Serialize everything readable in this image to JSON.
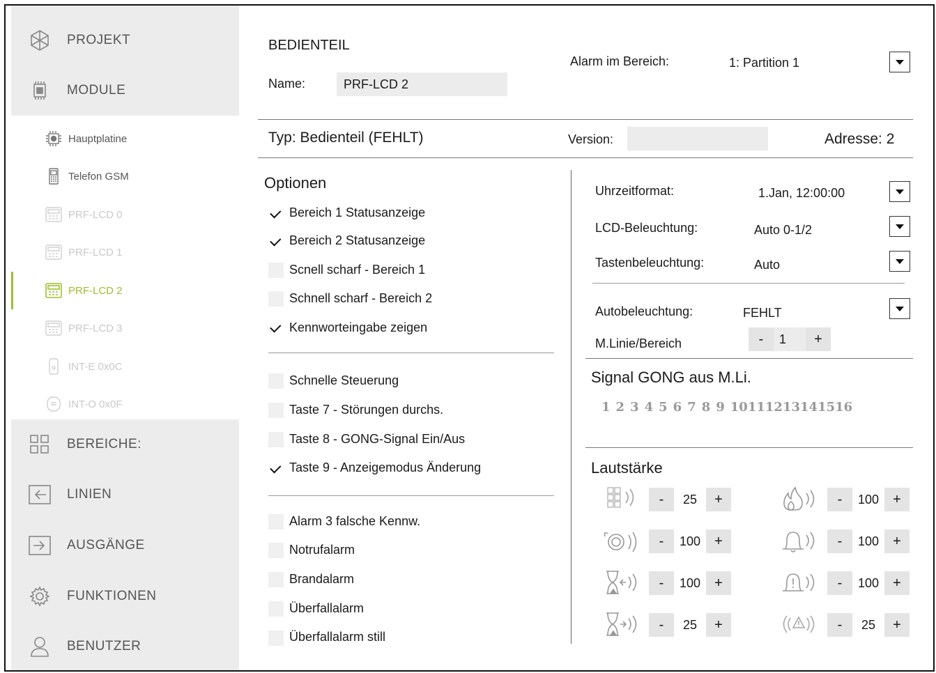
{
  "sidebar": {
    "main_top": [
      {
        "label": "PROJEKT",
        "icon": "project-icon"
      },
      {
        "label": "MODULE",
        "icon": "module-icon"
      }
    ],
    "sub_items": [
      {
        "label": "Hauptplatine",
        "state": "normal"
      },
      {
        "label": "Telefon GSM",
        "state": "normal"
      },
      {
        "label": "PRF-LCD 0",
        "state": "disabled"
      },
      {
        "label": "PRF-LCD 1",
        "state": "disabled"
      },
      {
        "label": "PRF-LCD 2",
        "state": "active"
      },
      {
        "label": "PRF-LCD 3",
        "state": "disabled"
      },
      {
        "label": "INT-E 0x0C",
        "state": "disabled"
      },
      {
        "label": "INT-O 0x0F",
        "state": "disabled"
      }
    ],
    "main_bottom": [
      {
        "label": "BEREICHE:",
        "icon": "partitions-icon"
      },
      {
        "label": "LINIEN",
        "icon": "zones-icon"
      },
      {
        "label": "AUSGÄNGE",
        "icon": "outputs-icon"
      },
      {
        "label": "FUNKTIONEN",
        "icon": "functions-icon"
      },
      {
        "label": "BENUTZER",
        "icon": "user-icon"
      }
    ],
    "accent_color": "#9cbf2b"
  },
  "header": {
    "title": "BEDIENTEIL",
    "name_label": "Name:",
    "name_value": "PRF-LCD 2",
    "alarm_label": "Alarm im Bereich:",
    "alarm_value": "1: Partition 1"
  },
  "typebar": {
    "type_text": "Typ: Bedienteil (FEHLT)",
    "version_label": "Version:",
    "version_value": "",
    "address_text": "Adresse: 2"
  },
  "options": {
    "heading": "Optionen",
    "group1": [
      {
        "label": "Bereich 1 Statusanzeige",
        "checked": true
      },
      {
        "label": "Bereich 2 Statusanzeige",
        "checked": true
      },
      {
        "label": "Scnell scharf - Bereich 1",
        "checked": false
      },
      {
        "label": "Schnell scharf - Bereich 2",
        "checked": false
      },
      {
        "label": "Kennworteingabe zeigen",
        "checked": true
      }
    ],
    "group2": [
      {
        "label": "Schnelle Steuerung",
        "checked": false
      },
      {
        "label": "Taste 7 - Störungen durchs.",
        "checked": false
      },
      {
        "label": "Taste 8 - GONG-Signal Ein/Aus",
        "checked": false
      },
      {
        "label": "Taste 9 - Anzeigemodus Änderung",
        "checked": true
      }
    ],
    "group3": [
      {
        "label": "Alarm 3 falsche Kennw.",
        "checked": false
      },
      {
        "label": "Notrufalarm",
        "checked": false
      },
      {
        "label": "Brandalarm",
        "checked": false
      },
      {
        "label": "Überfallalarm",
        "checked": false
      },
      {
        "label": "Überfallalarm still",
        "checked": false
      }
    ]
  },
  "settings": {
    "time_format_label": "Uhrzeitformat:",
    "time_format_value": "1.Jan, 12:00:00",
    "lcd_light_label": "LCD-Beleuchtung:",
    "lcd_light_value": "Auto 0-1/2",
    "key_light_label": "Tastenbeleuchtung:",
    "key_light_value": "Auto",
    "auto_light_label": "Autobeleuchtung:",
    "auto_light_value": "FEHLT",
    "zone_part_label": "M.Linie/Bereich",
    "zone_part_value": "1"
  },
  "gong": {
    "heading": "Signal GONG aus M.Li.",
    "numbers": [
      "1",
      "2",
      "3",
      "4",
      "5",
      "6",
      "7",
      "8",
      "9",
      "10",
      "11",
      "12",
      "13",
      "14",
      "15",
      "16"
    ]
  },
  "volume": {
    "heading": "Lautstärke",
    "left": [
      {
        "icon": "keypad-sound-icon",
        "value": "25"
      },
      {
        "icon": "alarm-siren-icon",
        "value": "100"
      },
      {
        "icon": "entry-delay-icon",
        "value": "100"
      },
      {
        "icon": "exit-delay-icon",
        "value": "25"
      }
    ],
    "right": [
      {
        "icon": "fire-alarm-icon",
        "value": "100"
      },
      {
        "icon": "bell-icon",
        "value": "100"
      },
      {
        "icon": "bell-warning-icon",
        "value": "100"
      },
      {
        "icon": "warning-icon",
        "value": "25"
      }
    ],
    "minus": "-",
    "plus": "+"
  }
}
